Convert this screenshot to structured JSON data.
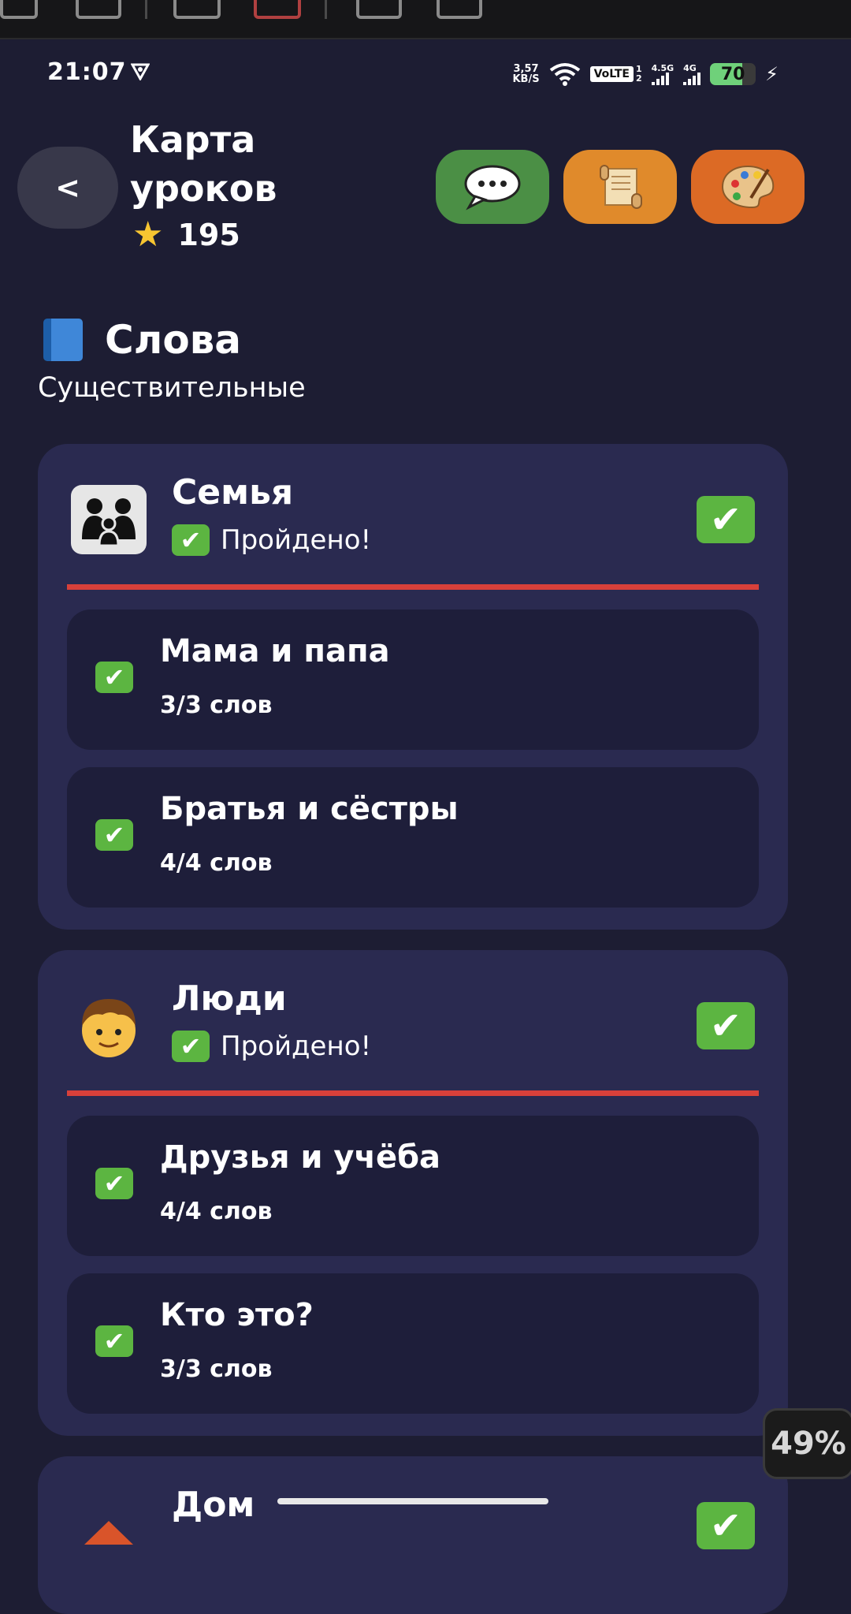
{
  "status_bar": {
    "time": "21:07",
    "net_speed_value": "3,57",
    "net_speed_unit": "KB/S",
    "volte": "VoLTE",
    "sim1": "1",
    "sim2": "2",
    "signal1_label": "4.5G",
    "signal2_label": "4G",
    "battery": "70",
    "battery_level": 0.7
  },
  "header": {
    "back_label": "<",
    "title": "Карта уроков",
    "stars_count": "195",
    "buttons": [
      {
        "name": "chat",
        "icon": "speech-bubble-icon",
        "color": "#4b8f45"
      },
      {
        "name": "scroll",
        "icon": "scroll-icon",
        "color": "#e08a2b"
      },
      {
        "name": "palette",
        "icon": "palette-icon",
        "color": "#dc6a25"
      }
    ]
  },
  "section": {
    "icon": "blue-book-icon",
    "title": "Слова",
    "subtitle": "Существительные"
  },
  "categories": [
    {
      "icon": "family-icon",
      "title": "Семья",
      "status": "Пройдено!",
      "lessons": [
        {
          "title": "Мама и папа",
          "count": "3/3 слов"
        },
        {
          "title": "Братья и сёстры",
          "count": "4/4 слов"
        }
      ]
    },
    {
      "icon": "boy-icon",
      "title": "Люди",
      "status": "Пройдено!",
      "lessons": [
        {
          "title": "Друзья и учёба",
          "count": "4/4 слов"
        },
        {
          "title": "Кто это?",
          "count": "3/3 слов"
        }
      ]
    },
    {
      "icon": "house-icon",
      "title": "Дом"
    }
  ],
  "overlay": {
    "percent": "49%"
  },
  "colors": {
    "background": "#1d1d33",
    "card": "#2a2a50",
    "lesson": "#1e1e3a",
    "check": "#5cb541",
    "divider": "#d8403a"
  }
}
